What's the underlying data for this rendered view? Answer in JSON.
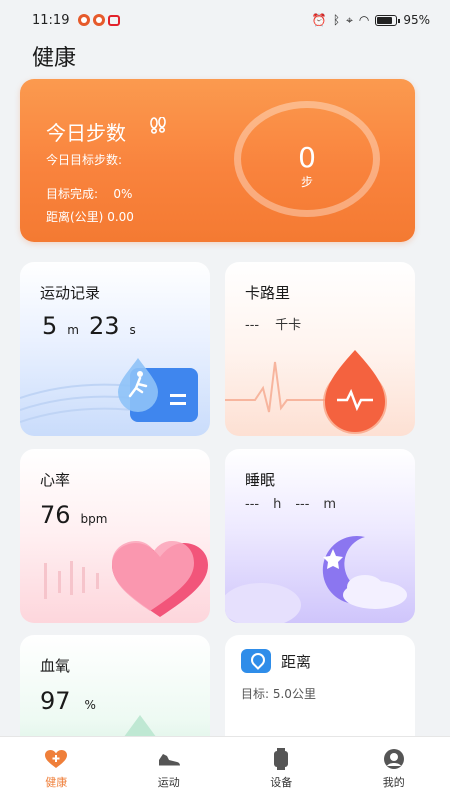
{
  "status_bar": {
    "time": "11:19",
    "battery": "95%"
  },
  "page": {
    "title": "健康"
  },
  "steps": {
    "title": "今日步数",
    "goal_label": "今日目标步数:",
    "completion_label": "目标完成:",
    "completion_value": "0%",
    "distance_label": "距离(公里)",
    "distance_value": "0.00",
    "count": "0",
    "unit": "步"
  },
  "cards": {
    "exercise": {
      "title": "运动记录",
      "minutes": "5",
      "min_unit": "m",
      "seconds": "23",
      "sec_unit": "s"
    },
    "calories": {
      "title": "卡路里",
      "value": "---",
      "unit": "千卡"
    },
    "heart_rate": {
      "title": "心率",
      "value": "76",
      "unit": "bpm"
    },
    "sleep": {
      "title": "睡眠",
      "hours": "---",
      "h_unit": "h",
      "minutes": "---",
      "m_unit": "m"
    },
    "oxygen": {
      "title": "血氧",
      "value": "97",
      "unit": "%"
    },
    "distance": {
      "title": "距离",
      "goal": "目标:  5.0公里"
    }
  },
  "nav": [
    {
      "label": "健康",
      "icon": "heart-plus-icon",
      "active": true
    },
    {
      "label": "运动",
      "icon": "shoe-icon",
      "active": false
    },
    {
      "label": "设备",
      "icon": "watch-icon",
      "active": false
    },
    {
      "label": "我的",
      "icon": "profile-icon",
      "active": false
    }
  ],
  "colors": {
    "accent": "#ef7f3a",
    "steps_card": "#f9833d"
  }
}
